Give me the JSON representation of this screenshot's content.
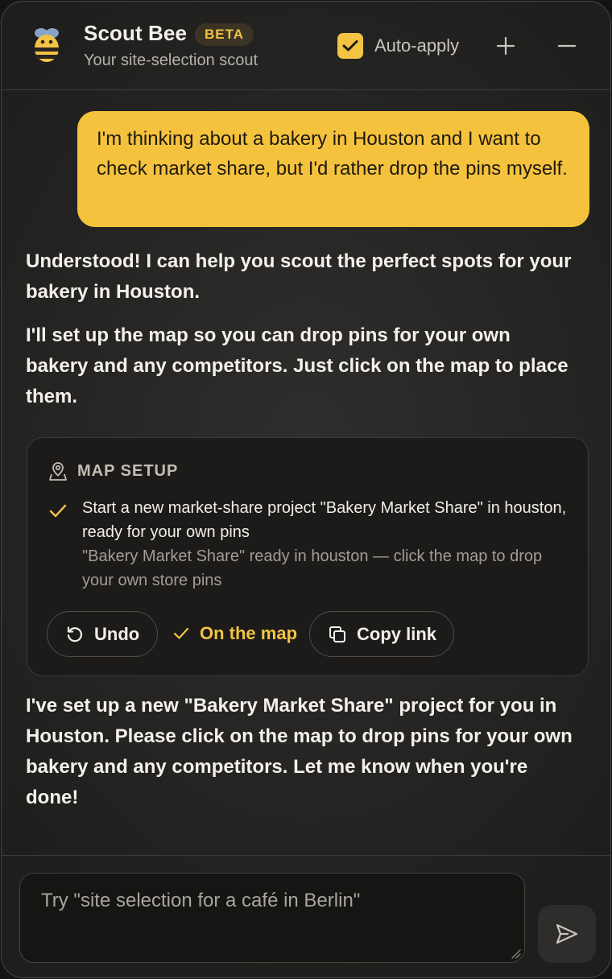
{
  "header": {
    "title": "Scout Bee",
    "badge": "BETA",
    "subtitle": "Your site-selection scout",
    "auto_apply_label": "Auto-apply",
    "auto_apply_checked": true,
    "logo_icon": "bee-icon",
    "add_icon": "plus-icon",
    "minimize_icon": "minus-icon"
  },
  "conversation": {
    "user_message": "I'm thinking about a bakery in Houston and I want to check market share, but I'd rather drop the pins myself.",
    "assistant_message_1": "Understood! I can help you scout the perfect spots for your bakery in Houston.",
    "assistant_message_2": "I'll set up the map so you can drop pins for your own bakery and any competitors. Just click on the map to place them.",
    "map_setup": {
      "title": "MAP SETUP",
      "step_main": "Start a new market-share project \"Bakery Market Share\" in houston, ready for your own pins",
      "step_detail": "\"Bakery Market Share\" ready in houston — click the map to drop your own store pins",
      "undo_label": "Undo",
      "on_map_label": "On the map",
      "copy_link_label": "Copy link"
    },
    "assistant_message_3": "I've set up a new \"Bakery Market Share\" project for you in Houston. Please click on the map to drop pins for your own bakery and any competitors. Let me know when you're done!"
  },
  "composer": {
    "placeholder": "Try \"site selection for a café in Berlin\"",
    "value": "",
    "send_icon": "send-icon"
  },
  "colors": {
    "accent": "#f3c343",
    "user_bubble": "#f5c23d",
    "panel_bg": "#262524",
    "card_bg": "#1c1b1a"
  }
}
